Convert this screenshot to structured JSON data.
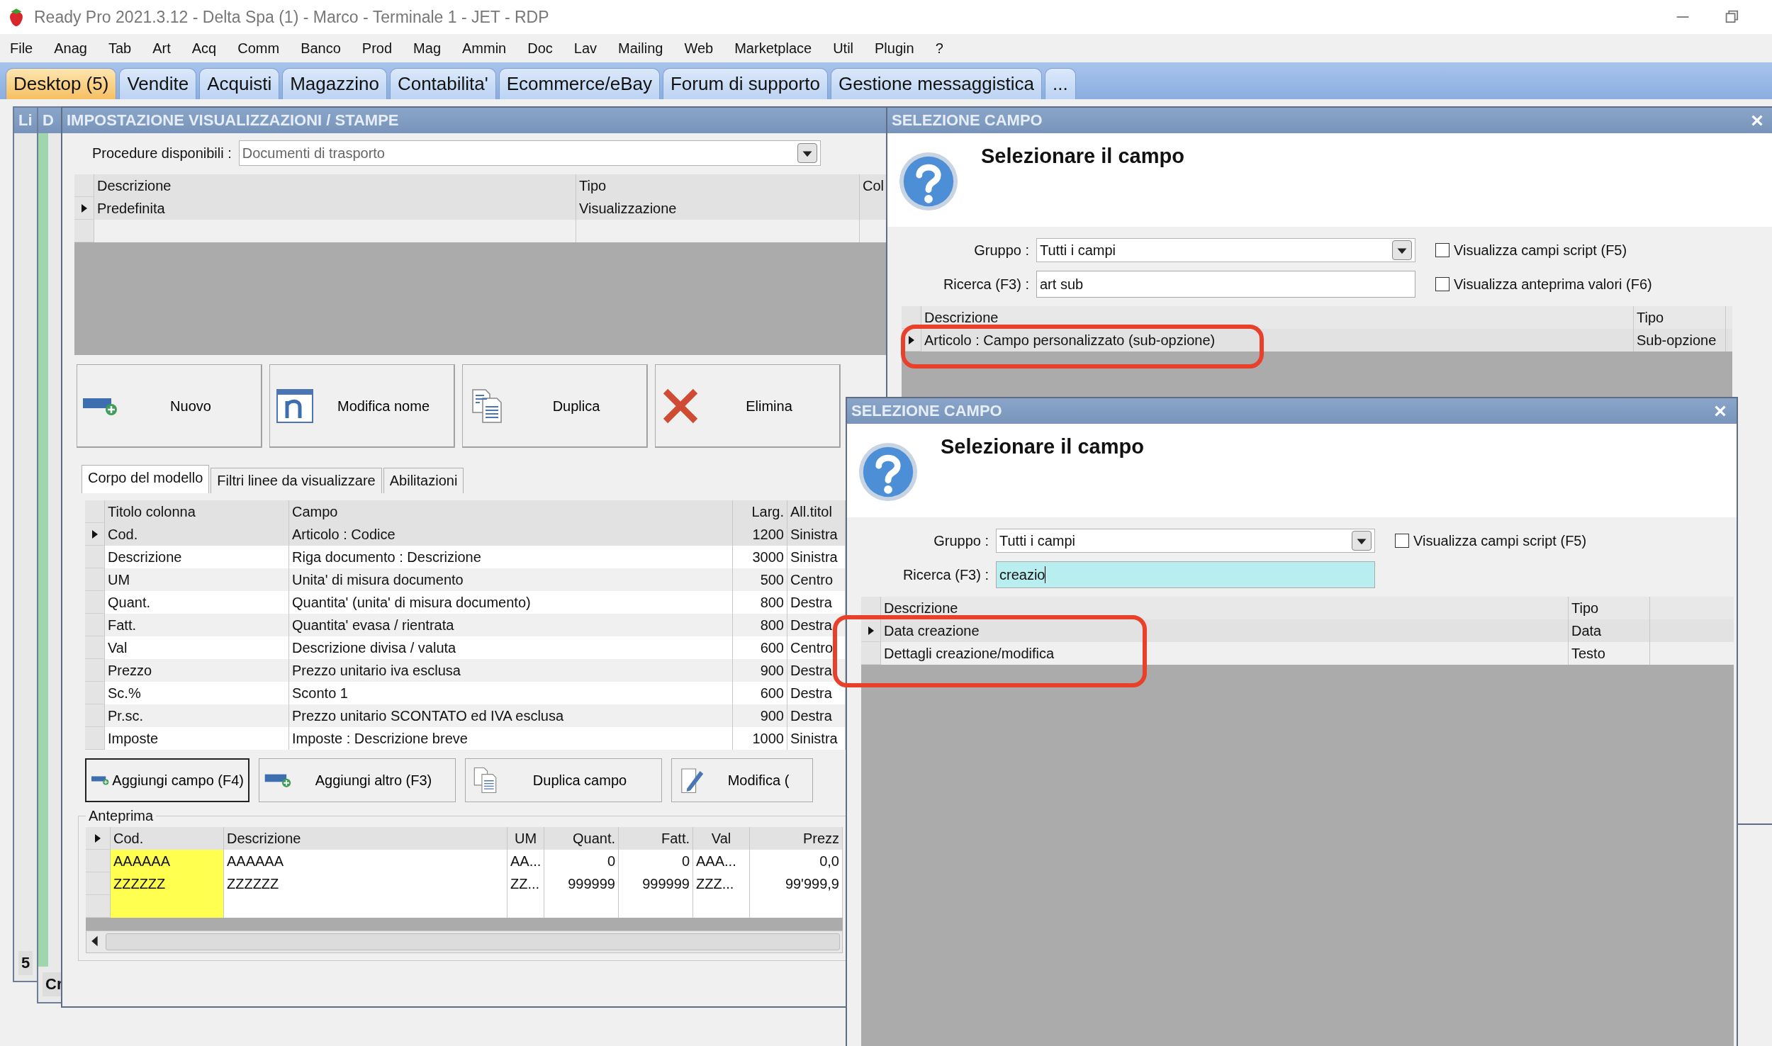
{
  "app_title": "Ready Pro 2021.3.12 - Delta Spa (1) - Marco - Terminale 1 - JET - RDP",
  "menu": [
    "File",
    "Anag",
    "Tab",
    "Art",
    "Acq",
    "Comm",
    "Banco",
    "Prod",
    "Mag",
    "Ammin",
    "Doc",
    "Lav",
    "Mailing",
    "Web",
    "Marketplace",
    "Util",
    "Plugin",
    "?"
  ],
  "tabs": [
    {
      "label": "Desktop (5)",
      "selected": true
    },
    {
      "label": "Vendite",
      "selected": false
    },
    {
      "label": "Acquisti",
      "selected": false
    },
    {
      "label": "Magazzino",
      "selected": false
    },
    {
      "label": "Contabilita'",
      "selected": false
    },
    {
      "label": "Ecommerce/eBay",
      "selected": false
    },
    {
      "label": "Forum di supporto",
      "selected": false
    },
    {
      "label": "Gestione messaggistica",
      "selected": false
    },
    {
      "label": "...",
      "selected": false
    }
  ],
  "background_windows": [
    {
      "title": "Li",
      "footer": "5"
    },
    {
      "title": "D",
      "footer": "Cr"
    }
  ],
  "settings_dialog": {
    "title": "IMPOSTAZIONE VISUALIZZAZIONI / STAMPE",
    "procedure_label": "Procedure disponibili :",
    "procedure_value": "Documenti di trasporto",
    "models_table": {
      "columns": [
        "Descrizione",
        "Tipo",
        "Col"
      ],
      "rows": [
        {
          "cells": [
            "Predefinita",
            "Visualizzazione"
          ],
          "selected": true
        }
      ]
    },
    "actions": [
      {
        "label": "Nuovo",
        "kind": "new"
      },
      {
        "label": "Modifica nome",
        "kind": "rename"
      },
      {
        "label": "Duplica",
        "kind": "duplicate"
      },
      {
        "label": "Elimina",
        "kind": "delete"
      }
    ],
    "subtabs": [
      {
        "label": "Corpo del modello",
        "selected": true
      },
      {
        "label": "Filtri linee da visualizzare",
        "selected": false
      },
      {
        "label": "Abilitazioni",
        "selected": false
      }
    ],
    "columns_table": {
      "columns": [
        "Titolo colonna",
        "Campo",
        "Larg.",
        "All.titol"
      ],
      "rows": [
        {
          "cells": [
            "Cod.",
            "Articolo : Codice",
            "1200",
            "Sinistra"
          ],
          "selected": true
        },
        {
          "cells": [
            "Descrizione",
            "Riga documento : Descrizione",
            "3000",
            "Sinistra"
          ],
          "selected": false
        },
        {
          "cells": [
            "UM",
            "Unita' di misura documento",
            "500",
            "Centro"
          ],
          "selected": false
        },
        {
          "cells": [
            "Quant.",
            "Quantita' (unita' di misura documento)",
            "800",
            "Destra"
          ],
          "selected": false
        },
        {
          "cells": [
            "Fatt.",
            "Quantita' evasa / rientrata",
            "800",
            "Destra"
          ],
          "selected": false
        },
        {
          "cells": [
            "Val",
            "Descrizione divisa / valuta",
            "600",
            "Centro"
          ],
          "selected": false
        },
        {
          "cells": [
            "Prezzo",
            "Prezzo unitario iva esclusa",
            "900",
            "Destra"
          ],
          "selected": false
        },
        {
          "cells": [
            "Sc.%",
            "Sconto 1",
            "600",
            "Destra"
          ],
          "selected": false
        },
        {
          "cells": [
            "Pr.sc.",
            "Prezzo unitario SCONTATO ed IVA esclusa",
            "900",
            "Destra"
          ],
          "selected": false
        },
        {
          "cells": [
            "Imposte",
            "Imposte : Descrizione breve",
            "1000",
            "Sinistra"
          ],
          "selected": false
        }
      ]
    },
    "field_buttons": [
      {
        "label": "Aggiungi campo (F4)",
        "kind": "new",
        "focused": true
      },
      {
        "label": "Aggiungi altro (F3)",
        "kind": "new",
        "focused": false
      },
      {
        "label": "Duplica campo",
        "kind": "duplicate",
        "focused": false
      },
      {
        "label": "Modifica (",
        "kind": "edit",
        "focused": false
      }
    ],
    "preview": {
      "label": "Anteprima",
      "columns": [
        "Cod.",
        "Descrizione",
        "UM",
        "Quant.",
        "Fatt.",
        "Val",
        "Prezz"
      ],
      "rows": [
        {
          "cells": [
            "AAAAAA",
            "AAAAAA",
            "AA...",
            "0",
            "0",
            "AAA...",
            "0,0"
          ]
        },
        {
          "cells": [
            "ZZZZZZ",
            "ZZZZZZ",
            "ZZ...",
            "999999",
            "999999",
            "ZZZ...",
            "99'999,9"
          ]
        }
      ]
    }
  },
  "select_dialogs": [
    {
      "title": "SELEZIONE CAMPO",
      "heading": "Selezionare il campo",
      "group_label": "Gruppo :",
      "group_value": "Tutti i campi",
      "search_label": "Ricerca (F3) :",
      "search_value": "art sub",
      "search_focused": false,
      "options": [
        {
          "label": "Visualizza campi script (F5)",
          "checked": false
        },
        {
          "label": "Visualizza anteprima valori (F6)",
          "checked": false
        }
      ],
      "columns": [
        "Descrizione",
        "Tipo"
      ],
      "rows": [
        {
          "cells": [
            "Articolo : Campo personalizzato (sub-opzione)",
            "Sub-opzione"
          ],
          "selected": true
        }
      ],
      "highlighted": true
    },
    {
      "title": "SELEZIONE CAMPO",
      "heading": "Selezionare il campo",
      "group_label": "Gruppo :",
      "group_value": "Tutti i campi",
      "search_label": "Ricerca (F3) :",
      "search_value": "creazio",
      "search_focused": true,
      "options": [
        {
          "label": "Visualizza campi script (F5)",
          "checked": false
        }
      ],
      "columns": [
        "Descrizione",
        "Tipo"
      ],
      "rows": [
        {
          "cells": [
            "Data creazione",
            "Data"
          ],
          "selected": true
        },
        {
          "cells": [
            "Dettagli creazione/modifica",
            "Testo"
          ],
          "selected": false
        }
      ],
      "highlighted": true
    }
  ]
}
